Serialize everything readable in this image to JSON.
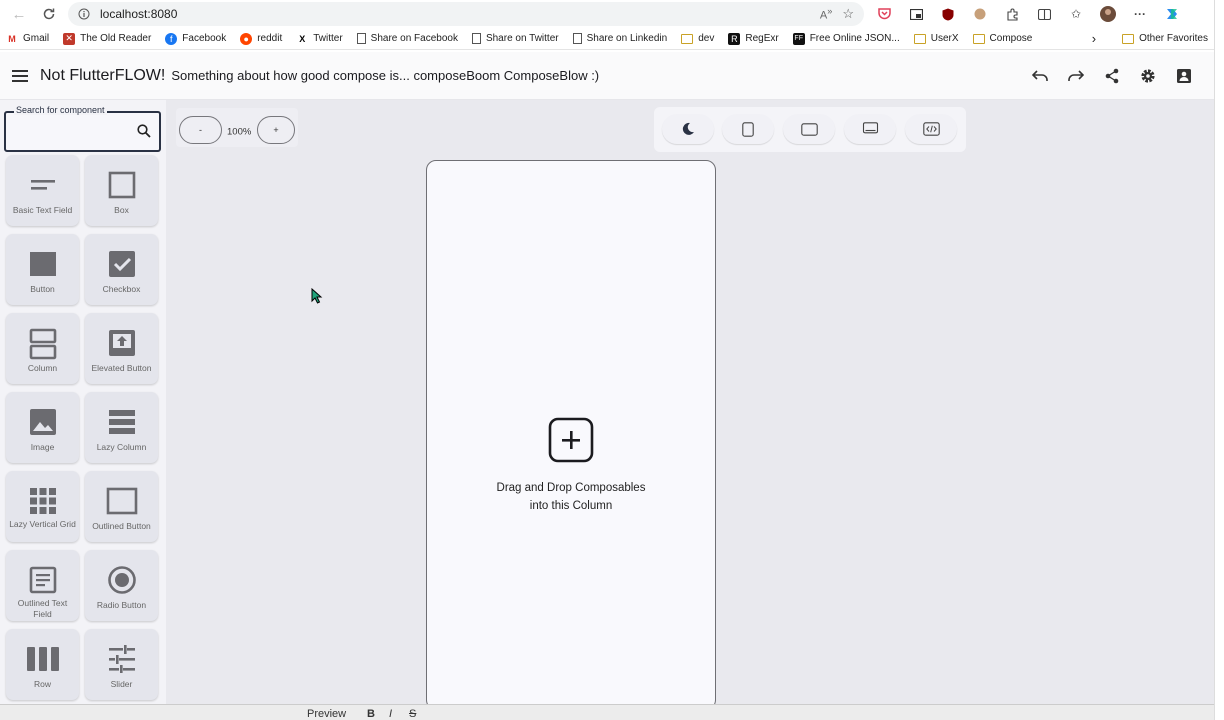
{
  "browser": {
    "url": "localhost:8080",
    "bookmarks": [
      {
        "label": "Gmail",
        "icon": "gmail-icon"
      },
      {
        "label": "The Old Reader",
        "icon": "old-reader-icon"
      },
      {
        "label": "Facebook",
        "icon": "facebook-icon"
      },
      {
        "label": "reddit",
        "icon": "reddit-icon"
      },
      {
        "label": "Twitter",
        "icon": "x-icon"
      },
      {
        "label": "Share on Facebook",
        "icon": "page-icon"
      },
      {
        "label": "Share on Twitter",
        "icon": "page-icon"
      },
      {
        "label": "Share on Linkedin",
        "icon": "page-icon"
      },
      {
        "label": "dev",
        "icon": "folder-icon"
      },
      {
        "label": "RegExr",
        "icon": "regexr-icon"
      },
      {
        "label": "Free Online JSON...",
        "icon": "ff-icon"
      },
      {
        "label": "UserX",
        "icon": "folder-icon"
      },
      {
        "label": "Compose",
        "icon": "folder-icon"
      }
    ],
    "other_favorites": "Other Favorites"
  },
  "app": {
    "title": "Not FlutterFLOW!",
    "subtitle": "Something about how good compose is... composeBoom ComposeBlow :)"
  },
  "sidebar": {
    "search_label": "Search for component",
    "search_value": "",
    "components": [
      {
        "label": "Basic Text Field",
        "icon": "short-text-icon"
      },
      {
        "label": "Box",
        "icon": "box-outline-icon"
      },
      {
        "label": "Button",
        "icon": "filled-rect-icon"
      },
      {
        "label": "Checkbox",
        "icon": "checkbox-icon"
      },
      {
        "label": "Column",
        "icon": "column-icon"
      },
      {
        "label": "Elevated Button",
        "icon": "upload-box-icon"
      },
      {
        "label": "Image",
        "icon": "image-icon"
      },
      {
        "label": "Lazy Column",
        "icon": "lazy-column-icon"
      },
      {
        "label": "Lazy Vertical Grid",
        "icon": "grid-icon"
      },
      {
        "label": "Outlined Button",
        "icon": "outlined-rect-icon"
      },
      {
        "label": "Outlined Text Field",
        "icon": "article-icon"
      },
      {
        "label": "Radio Button",
        "icon": "radio-icon"
      },
      {
        "label": "Row",
        "icon": "row-icon"
      },
      {
        "label": "Slider",
        "icon": "tune-icon"
      }
    ]
  },
  "zoom": {
    "minus": "-",
    "value": "100%",
    "plus": "+"
  },
  "canvas": {
    "drop_line1": "Drag and Drop Composables",
    "drop_line2": "into this Column"
  },
  "footer": {
    "preview": "Preview"
  },
  "colors": {
    "accent": "#2a3244",
    "tile_bg": "#e4e5ec",
    "workspace_bg": "#e9e9ee",
    "icon_gray": "#6b6b70",
    "cursor": "#1fa37a"
  }
}
